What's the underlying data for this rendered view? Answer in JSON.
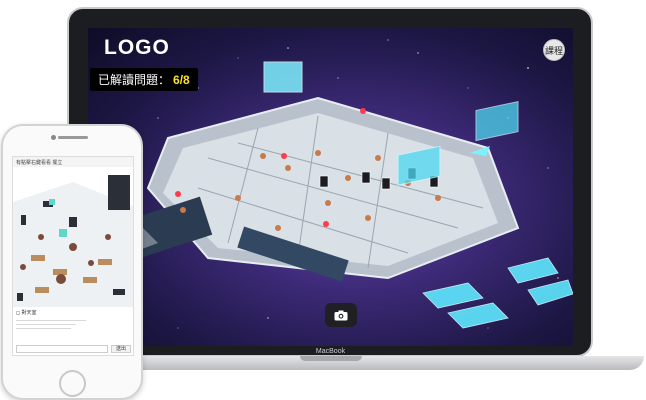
{
  "game": {
    "logo": "LOGO",
    "progress_label": "已解讀問題：",
    "progress_value": "6/8",
    "course_button": "課程",
    "camera_icon": "camera-icon"
  },
  "laptop": {
    "brand": "MacBook"
  },
  "phone": {
    "header_text": "有點擊右鍵看看 擺立",
    "chat_title": "對天室",
    "send_label": "送出"
  },
  "colors": {
    "accent_yellow": "#ffe12a",
    "space_purple": "#3d2a78",
    "hologram_cyan": "#6ef1ff"
  }
}
